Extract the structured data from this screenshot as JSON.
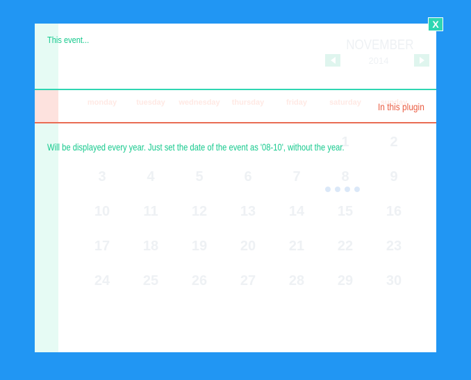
{
  "event": {
    "title": "This event...",
    "description": "Will be displayed every year. Just set the date of the event as '08-10', without the year.",
    "plugin_label": "In this plugin"
  },
  "calendar": {
    "month": "NOVEMBER",
    "year": "2014",
    "weekdays": [
      "monday",
      "tuesday",
      "wednesday",
      "thursday",
      "friday",
      "saturday",
      "sunday"
    ],
    "weeks": [
      [
        "",
        "",
        "",
        "",
        "",
        "1",
        "2"
      ],
      [
        "3",
        "4",
        "5",
        "6",
        "7",
        "8",
        "9"
      ],
      [
        "10",
        "11",
        "12",
        "13",
        "14",
        "15",
        "16"
      ],
      [
        "17",
        "18",
        "19",
        "20",
        "21",
        "22",
        "23"
      ],
      [
        "24",
        "25",
        "26",
        "27",
        "28",
        "29",
        "30"
      ]
    ]
  },
  "close_label": "X",
  "colors": {
    "background": "#2196f3",
    "accent": "#15c98d",
    "highlight": "#ea5b40"
  },
  "icons": {
    "prev": "triangle-left-icon",
    "next": "triangle-right-icon"
  }
}
